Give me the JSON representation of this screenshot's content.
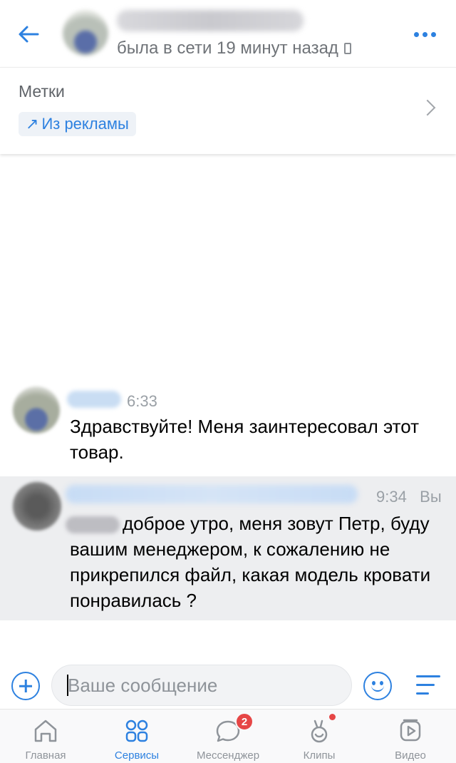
{
  "header": {
    "status": "была в сети 19 минут назад",
    "icons": {
      "back": "arrow-left-icon",
      "more": "more-dots-icon",
      "device": "phone-icon"
    }
  },
  "labels": {
    "title": "Метки",
    "tag_arrow": "↗",
    "tag": "Из рекламы"
  },
  "messages": [
    {
      "time": "6:33",
      "text": "Здравствуйте! Меня заинтересовал этот товар."
    },
    {
      "time": "9:34",
      "author": "Вы",
      "text": "доброе утро, меня зовут Петр, буду вашим менеджером, к сожалению не прикрепился файл, какая модель кровати понравилась ?"
    }
  ],
  "composer": {
    "placeholder": "Ваше сообщение",
    "icons": {
      "attach": "plus-circle-icon",
      "emoji": "smile-icon",
      "menu": "menu-lines-icon"
    }
  },
  "nav": {
    "items": [
      {
        "label": "Главная",
        "icon": "home-icon"
      },
      {
        "label": "Сервисы",
        "icon": "services-icon",
        "active": true
      },
      {
        "label": "Мессенджер",
        "icon": "messenger-icon",
        "badge": "2"
      },
      {
        "label": "Клипы",
        "icon": "clips-icon",
        "dot": true
      },
      {
        "label": "Видео",
        "icon": "video-icon"
      }
    ]
  },
  "colors": {
    "accent": "#2d81e0",
    "badge": "#e64646",
    "own_message_bg": "#edeef0"
  }
}
